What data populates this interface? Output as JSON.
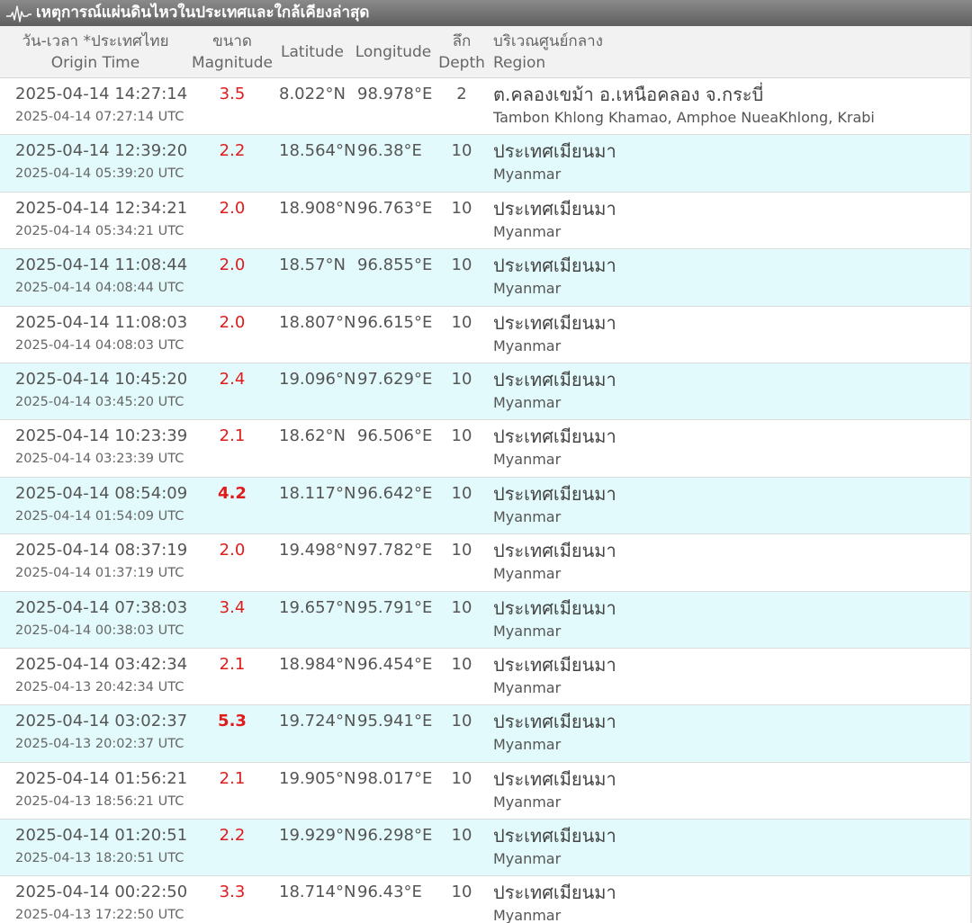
{
  "header": {
    "title": "เหตุการณ์แผ่นดินไหวในประเทศและใกล้เคียงล่าสุด",
    "title_icon": "seismograph-icon"
  },
  "columns": {
    "time_th": "วัน-เวลา *ประเทศไทย",
    "time_en": "Origin Time",
    "mag_th": "ขนาด",
    "mag_en": "Magnitude",
    "lat": "Latitude",
    "lon": "Longitude",
    "depth_th": "ลึก",
    "depth_en": "Depth",
    "region_th": "บริเวณศูนย์กลาง",
    "region_en": "Region"
  },
  "colors": {
    "magnitude": "#e01b1b",
    "alt_row": "#e2fafb",
    "header_bg": "#6f6f6f"
  },
  "events": [
    {
      "time": "2025-04-14 14:27:14",
      "utc": "2025-04-14 07:27:14 UTC",
      "mag": "3.5",
      "lat": "8.022°N",
      "lon": "98.978°E",
      "depth": "2",
      "region_th": "ต.คลองเขม้า อ.เหนือคลอง จ.กระบี่",
      "region_en": "Tambon Khlong Khamao, Amphoe NueaKhlong, Krabi"
    },
    {
      "time": "2025-04-14 12:39:20",
      "utc": "2025-04-14 05:39:20 UTC",
      "mag": "2.2",
      "lat": "18.564°N",
      "lon": "96.38°E",
      "depth": "10",
      "region_th": "ประเทศเมียนมา",
      "region_en": "Myanmar"
    },
    {
      "time": "2025-04-14 12:34:21",
      "utc": "2025-04-14 05:34:21 UTC",
      "mag": "2.0",
      "lat": "18.908°N",
      "lon": "96.763°E",
      "depth": "10",
      "region_th": "ประเทศเมียนมา",
      "region_en": "Myanmar"
    },
    {
      "time": "2025-04-14 11:08:44",
      "utc": "2025-04-14 04:08:44 UTC",
      "mag": "2.0",
      "lat": "18.57°N",
      "lon": "96.855°E",
      "depth": "10",
      "region_th": "ประเทศเมียนมา",
      "region_en": "Myanmar"
    },
    {
      "time": "2025-04-14 11:08:03",
      "utc": "2025-04-14 04:08:03 UTC",
      "mag": "2.0",
      "lat": "18.807°N",
      "lon": "96.615°E",
      "depth": "10",
      "region_th": "ประเทศเมียนมา",
      "region_en": "Myanmar"
    },
    {
      "time": "2025-04-14 10:45:20",
      "utc": "2025-04-14 03:45:20 UTC",
      "mag": "2.4",
      "lat": "19.096°N",
      "lon": "97.629°E",
      "depth": "10",
      "region_th": "ประเทศเมียนมา",
      "region_en": "Myanmar"
    },
    {
      "time": "2025-04-14 10:23:39",
      "utc": "2025-04-14 03:23:39 UTC",
      "mag": "2.1",
      "lat": "18.62°N",
      "lon": "96.506°E",
      "depth": "10",
      "region_th": "ประเทศเมียนมา",
      "region_en": "Myanmar"
    },
    {
      "time": "2025-04-14 08:54:09",
      "utc": "2025-04-14 01:54:09 UTC",
      "mag": "4.2",
      "lat": "18.117°N",
      "lon": "96.642°E",
      "depth": "10",
      "region_th": "ประเทศเมียนมา",
      "region_en": "Myanmar",
      "strong": true
    },
    {
      "time": "2025-04-14 08:37:19",
      "utc": "2025-04-14 01:37:19 UTC",
      "mag": "2.0",
      "lat": "19.498°N",
      "lon": "97.782°E",
      "depth": "10",
      "region_th": "ประเทศเมียนมา",
      "region_en": "Myanmar"
    },
    {
      "time": "2025-04-14 07:38:03",
      "utc": "2025-04-14 00:38:03 UTC",
      "mag": "3.4",
      "lat": "19.657°N",
      "lon": "95.791°E",
      "depth": "10",
      "region_th": "ประเทศเมียนมา",
      "region_en": "Myanmar"
    },
    {
      "time": "2025-04-14 03:42:34",
      "utc": "2025-04-13 20:42:34 UTC",
      "mag": "2.1",
      "lat": "18.984°N",
      "lon": "96.454°E",
      "depth": "10",
      "region_th": "ประเทศเมียนมา",
      "region_en": "Myanmar"
    },
    {
      "time": "2025-04-14 03:02:37",
      "utc": "2025-04-13 20:02:37 UTC",
      "mag": "5.3",
      "lat": "19.724°N",
      "lon": "95.941°E",
      "depth": "10",
      "region_th": "ประเทศเมียนมา",
      "region_en": "Myanmar",
      "strong": true
    },
    {
      "time": "2025-04-14 01:56:21",
      "utc": "2025-04-13 18:56:21 UTC",
      "mag": "2.1",
      "lat": "19.905°N",
      "lon": "98.017°E",
      "depth": "10",
      "region_th": "ประเทศเมียนมา",
      "region_en": "Myanmar"
    },
    {
      "time": "2025-04-14 01:20:51",
      "utc": "2025-04-13 18:20:51 UTC",
      "mag": "2.2",
      "lat": "19.929°N",
      "lon": "96.298°E",
      "depth": "10",
      "region_th": "ประเทศเมียนมา",
      "region_en": "Myanmar"
    },
    {
      "time": "2025-04-14 00:22:50",
      "utc": "2025-04-13 17:22:50 UTC",
      "mag": "3.3",
      "lat": "18.714°N",
      "lon": "96.43°E",
      "depth": "10",
      "region_th": "ประเทศเมียนมา",
      "region_en": "Myanmar"
    }
  ]
}
